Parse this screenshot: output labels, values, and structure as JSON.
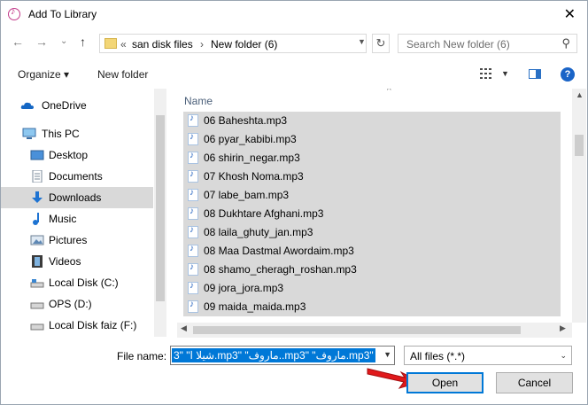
{
  "window": {
    "title": "Add To Library",
    "close_glyph": "✕"
  },
  "address": {
    "overflow_glyph": "«",
    "crumbs": [
      "san disk files",
      "New folder (6)"
    ],
    "separator": "›",
    "refresh_glyph": "↻"
  },
  "search": {
    "placeholder": "Search New folder (6)",
    "icon": "search-icon"
  },
  "toolbar": {
    "organize_label": "Organize ▾",
    "new_folder_label": "New folder",
    "help_label": "?"
  },
  "nav": {
    "items": [
      {
        "label": "OneDrive",
        "icon": "cloud-icon"
      },
      {
        "label": "This PC",
        "icon": "computer-icon"
      },
      {
        "label": "Desktop",
        "icon": "desktop-icon"
      },
      {
        "label": "Documents",
        "icon": "documents-icon"
      },
      {
        "label": "Downloads",
        "icon": "download-icon",
        "selected": true
      },
      {
        "label": "Music",
        "icon": "music-icon"
      },
      {
        "label": "Pictures",
        "icon": "pictures-icon"
      },
      {
        "label": "Videos",
        "icon": "videos-icon"
      },
      {
        "label": "Local Disk (C:)",
        "icon": "drive-icon"
      },
      {
        "label": "OPS (D:)",
        "icon": "drive-icon"
      },
      {
        "label": "Local Disk faiz (F:)",
        "icon": "drive-icon"
      }
    ]
  },
  "files": {
    "column_header": "Name",
    "rows": [
      "06 Baheshta.mp3",
      "06 pyar_kabibi.mp3",
      "06 shirin_negar.mp3",
      "07 Khosh Noma.mp3",
      "07 labe_bam.mp3",
      "08 Dukhtare Afghani.mp3",
      "08 laila_ghuty_jan.mp3",
      "08 Maa Dastmal Awordaim.mp3",
      "08 shamo_cheragh_roshan.mp3",
      "09 jora_jora.mp3",
      "09 maida_maida.mp3"
    ]
  },
  "filename": {
    "label": "File name:",
    "value": "3\" \"شیلا ا.mp3\" \"ماروف..mp3\" \"ماروف.mp3\""
  },
  "filetype": {
    "value": "All files (*.*)"
  },
  "buttons": {
    "open": "Open",
    "cancel": "Cancel"
  },
  "colors": {
    "accent": "#0078d7",
    "selection": "#d9d9d9",
    "annotation_arrow": "#e0191b"
  }
}
